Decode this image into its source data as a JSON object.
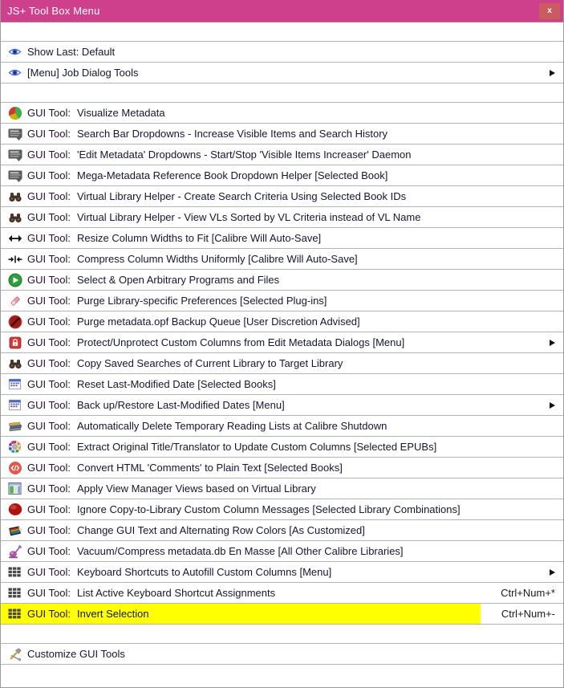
{
  "window": {
    "title": "JS+ Tool Box Menu",
    "close_label": "x"
  },
  "colors": {
    "titlebar_pink": "#ce3f8c",
    "close_button_red": "#ca5c60",
    "highlight_yellow": "#ffff00",
    "separator_gray": "#b3b3b3",
    "border_gray": "#9a9a9a"
  },
  "prefix_label": "GUI Tool:",
  "top_items": [
    {
      "icon": "eye-icon",
      "label": "Show Last: Default",
      "submenu": false
    },
    {
      "icon": "eye-icon",
      "label": "[Menu] Job Dialog Tools",
      "submenu": true
    }
  ],
  "tool_items": [
    {
      "icon": "pie-chart-icon",
      "label": "Visualize Metadata"
    },
    {
      "icon": "dropdown-list-icon",
      "label": "Search Bar Dropdowns - Increase Visible Items and Search History"
    },
    {
      "icon": "dropdown-list-icon",
      "label": "'Edit Metadata' Dropdowns - Start/Stop 'Visible Items Increaser' Daemon"
    },
    {
      "icon": "dropdown-list-icon",
      "label": "Mega-Metadata Reference Book Dropdown Helper [Selected Book]"
    },
    {
      "icon": "binoculars-icon",
      "label": "Virtual Library Helper - Create Search Criteria Using Selected Book IDs"
    },
    {
      "icon": "binoculars-icon",
      "label": "Virtual Library Helper - View VLs Sorted by VL Criteria instead of VL Name"
    },
    {
      "icon": "resize-horizontal-icon",
      "label": "Resize Column Widths to Fit [Calibre Will Auto-Save]"
    },
    {
      "icon": "compress-horizontal-icon",
      "label": "Compress Column Widths Uniformly [Calibre Will Auto-Save]"
    },
    {
      "icon": "play-circle-icon",
      "label": "Select & Open Arbitrary Programs and Files"
    },
    {
      "icon": "eraser-icon",
      "label": "Purge Library-specific Preferences [Selected Plug-ins]"
    },
    {
      "icon": "no-entry-icon",
      "label": "Purge metadata.opf Backup Queue [User Discretion Advised]"
    },
    {
      "icon": "lock-icon",
      "label": "Protect/Unprotect Custom Columns from Edit Metadata Dialogs [Menu]",
      "submenu": true
    },
    {
      "icon": "binoculars-icon",
      "label": "Copy Saved Searches of Current Library to Target Library"
    },
    {
      "icon": "calendar-icon",
      "label": "Reset Last-Modified Date [Selected Books]"
    },
    {
      "icon": "calendar-icon",
      "label": "Back up/Restore Last-Modified Dates [Menu]",
      "submenu": true
    },
    {
      "icon": "books-icon",
      "label": "Automatically Delete Temporary Reading Lists at Calibre Shutdown"
    },
    {
      "icon": "color-wheel-icon",
      "label": "Extract Original Title/Translator to Update Custom Columns [Selected EPUBs]"
    },
    {
      "icon": "code-circle-icon",
      "label": "Convert HTML 'Comments' to Plain Text [Selected Books]"
    },
    {
      "icon": "view-manager-icon",
      "label": "Apply View Manager Views based on Virtual Library"
    },
    {
      "icon": "stop-circle-icon",
      "label": "Ignore Copy-to-Library Custom Column Messages [Selected Library Combinations]"
    },
    {
      "icon": "palette-icon",
      "label": "Change GUI Text and Alternating Row Colors [As Customized]"
    },
    {
      "icon": "vacuum-icon",
      "label": "Vacuum/Compress metadata.db En Masse [All Other Calibre Libraries]"
    },
    {
      "icon": "keyboard-icon",
      "label": "Keyboard Shortcuts to Autofill Custom Columns [Menu]",
      "submenu": true
    },
    {
      "icon": "keyboard-icon",
      "label": "List Active Keyboard Shortcut Assignments",
      "shortcut": "Ctrl+Num+*"
    },
    {
      "icon": "keyboard-icon",
      "label": "Invert Selection",
      "shortcut": "Ctrl+Num+-",
      "highlighted": true
    }
  ],
  "footer_items": [
    {
      "icon": "tools-icon",
      "label": "Customize GUI Tools"
    }
  ]
}
